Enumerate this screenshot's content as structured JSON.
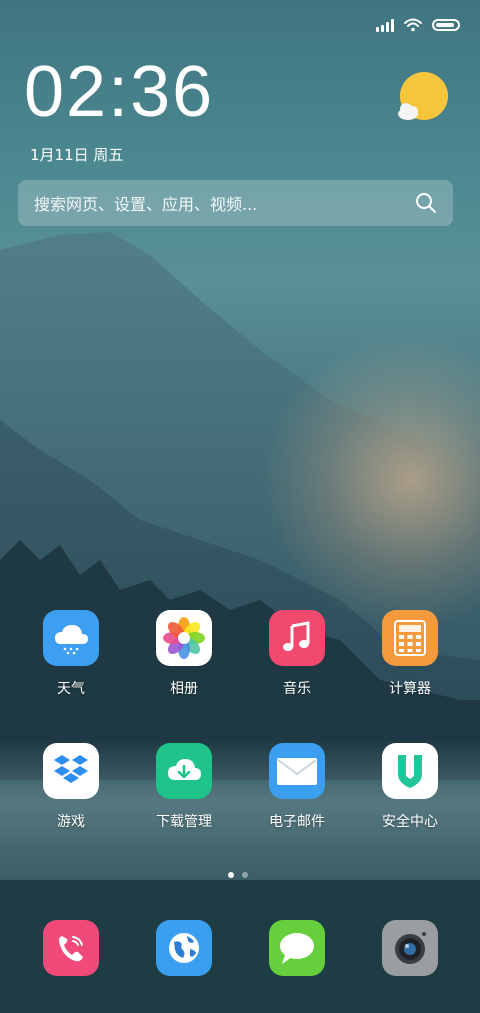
{
  "status_bar": {
    "battery_level": 0.9
  },
  "lock_widget": {
    "time": "02:36",
    "date": "1月11日 周五"
  },
  "search": {
    "placeholder": "搜索网页、设置、应用、视频..."
  },
  "apps": [
    {
      "label": "天气",
      "icon": "weather-cloud-icon",
      "color": "#3d9ff2"
    },
    {
      "label": "相册",
      "icon": "photos-flower-icon",
      "color": "#ffffff"
    },
    {
      "label": "音乐",
      "icon": "music-note-icon",
      "color": "#f1496d"
    },
    {
      "label": "计算器",
      "icon": "calculator-icon",
      "color": "#f59a3c"
    },
    {
      "label": "游戏",
      "icon": "dropbox-box-icon",
      "color": "#ffffff"
    },
    {
      "label": "下载管理",
      "icon": "download-cloud-icon",
      "color": "#1fc48a"
    },
    {
      "label": "电子邮件",
      "icon": "mail-envelope-icon",
      "color": "#3c9eee"
    },
    {
      "label": "安全中心",
      "icon": "shield-icon",
      "color": "#ffffff"
    }
  ],
  "page_indicator": {
    "pages": 2,
    "current": 1
  },
  "dock": [
    {
      "icon": "phone-icon",
      "color": "#f1497a"
    },
    {
      "icon": "browser-globe-icon",
      "color": "#3b9ff0"
    },
    {
      "icon": "messages-bubble-icon",
      "color": "#66cf3c"
    },
    {
      "icon": "camera-icon",
      "color": "#9a9ea3"
    }
  ]
}
